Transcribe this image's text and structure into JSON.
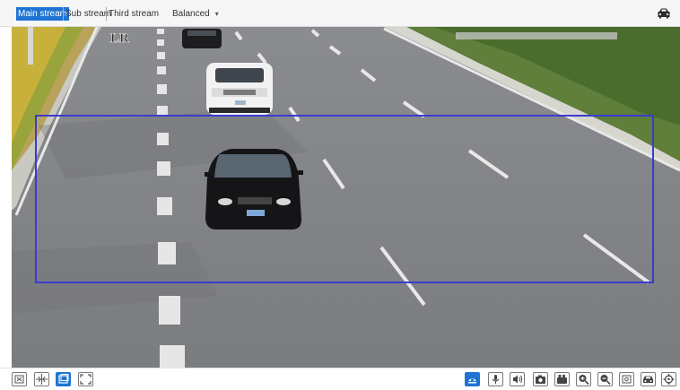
{
  "toolbar": {
    "streams": [
      {
        "label": "Main stream",
        "active": true
      },
      {
        "label": "Sub stream",
        "active": false
      },
      {
        "label": "Third stream",
        "active": false
      }
    ],
    "quality_label": "Balanced",
    "quality_caret": "▾",
    "right_icon": "car-icon"
  },
  "video": {
    "overlay_text": "LR",
    "plates": [
      "",
      ""
    ]
  },
  "bottom_left_icons": [
    "actual-size-icon",
    "fit-window-icon",
    "window-mode-icon",
    "fullscreen-icon"
  ],
  "bottom_right_icons": [
    "vehicle-detect-icon",
    "microphone-icon",
    "speaker-icon",
    "snapshot-icon",
    "record-icon",
    "zoom-in-icon",
    "zoom-out-icon",
    "digital-zoom-icon",
    "car-capture-icon",
    "ptz-icon"
  ],
  "colors": {
    "accent": "#1f74d3",
    "region": "#3b3bd1",
    "road": "#7d7f82"
  }
}
